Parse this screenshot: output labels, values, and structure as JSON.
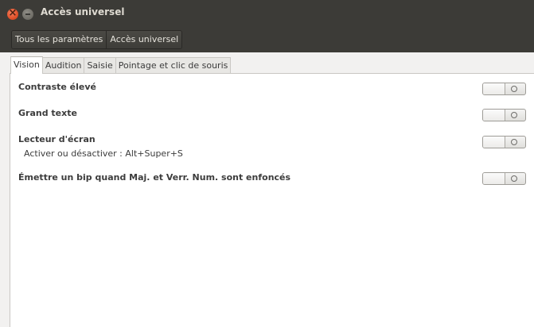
{
  "window": {
    "title": "Accès universel"
  },
  "breadcrumb": {
    "items": [
      "Tous les paramètres",
      "Accès universel"
    ]
  },
  "tabs": [
    "Vision",
    "Audition",
    "Saisie",
    "Pointage et clic de souris"
  ],
  "active_tab": "Vision",
  "settings": [
    {
      "label": "Contraste élevé",
      "state": "off"
    },
    {
      "label": "Grand texte",
      "state": "off"
    },
    {
      "label": "Lecteur d'écran",
      "sublabel": "Activer ou désactiver : Alt+Super+S",
      "state": "off"
    },
    {
      "label": "Émettre un bip quand Maj. et Verr. Num. sont enfoncés",
      "state": "off"
    }
  ],
  "icons": {
    "close": "close-icon",
    "minimize": "minimize-icon",
    "toggle_off": "off-circle-icon"
  },
  "colors": {
    "titlebar": "#3c3b37",
    "close": "#e0512a",
    "background": "#f2f1f0"
  }
}
